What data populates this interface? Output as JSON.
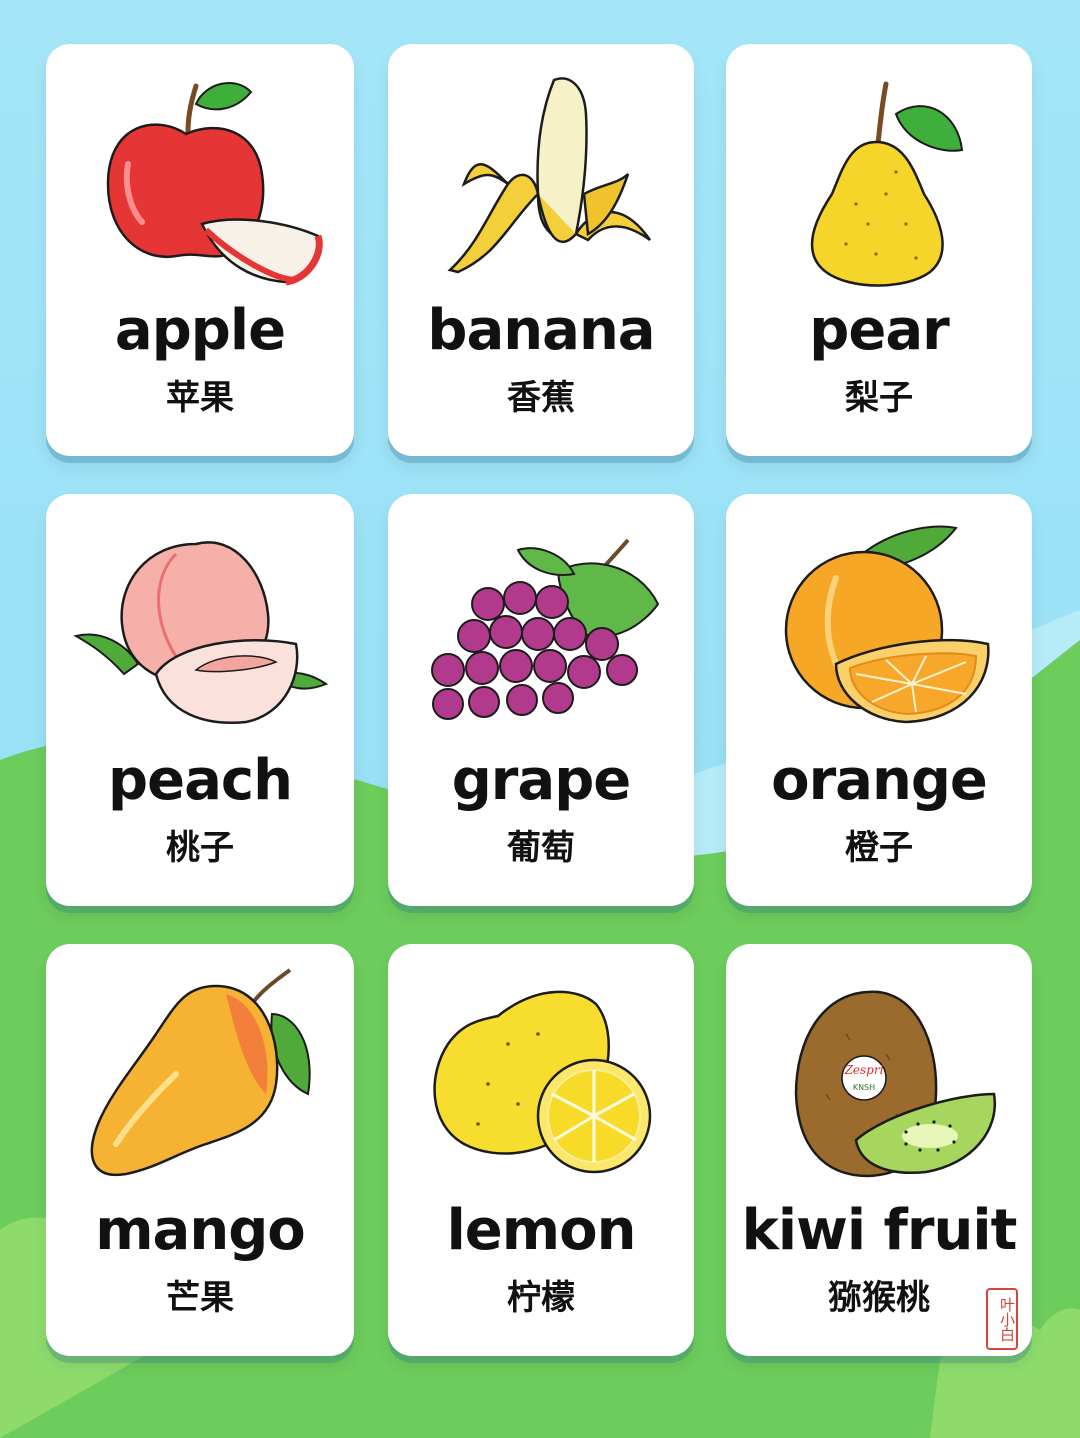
{
  "cards": [
    {
      "en": "apple",
      "zh": "苹果"
    },
    {
      "en": "banana",
      "zh": "香蕉"
    },
    {
      "en": "pear",
      "zh": "梨子"
    },
    {
      "en": "peach",
      "zh": "桃子"
    },
    {
      "en": "grape",
      "zh": "葡萄"
    },
    {
      "en": "orange",
      "zh": "橙子"
    },
    {
      "en": "mango",
      "zh": "芒果"
    },
    {
      "en": "lemon",
      "zh": "柠檬"
    },
    {
      "en": "kiwi fruit",
      "zh": "猕猴桃"
    }
  ],
  "kiwi_sticker": {
    "brand": "Zespri",
    "sub": "KNSH"
  },
  "seal": {
    "text": "叶小白"
  },
  "colors": {
    "sky": "#9fe3f7",
    "grass": "#66c85a",
    "grass_light": "#8fdc6e",
    "card": "#ffffff",
    "text": "#111111"
  }
}
